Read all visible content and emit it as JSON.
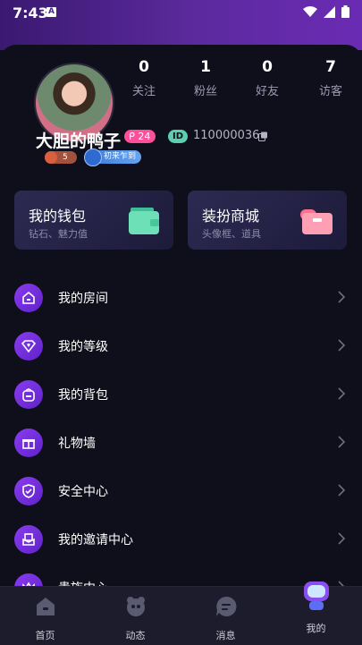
{
  "status_bar": {
    "time": "7:43",
    "notif_glyph": "A"
  },
  "profile": {
    "username": "大胆的鸭子",
    "level": "24",
    "id_label": "ID",
    "id_value": "110000036",
    "fire_level": "5",
    "newbie_badge": "初来乍到"
  },
  "stats": [
    {
      "num": "0",
      "label": "关注"
    },
    {
      "num": "1",
      "label": "粉丝"
    },
    {
      "num": "0",
      "label": "好友"
    },
    {
      "num": "7",
      "label": "访客"
    }
  ],
  "cards": {
    "wallet": {
      "title": "我的钱包",
      "subtitle": "钻石、魅力值"
    },
    "store": {
      "title": "装扮商城",
      "subtitle": "头像框、道具"
    }
  },
  "menu": [
    {
      "label": "我的房间",
      "icon": "home-icon"
    },
    {
      "label": "我的等级",
      "icon": "diamond-heart-icon"
    },
    {
      "label": "我的背包",
      "icon": "backpack-icon"
    },
    {
      "label": "礼物墙",
      "icon": "gift-icon"
    },
    {
      "label": "安全中心",
      "icon": "shield-icon"
    },
    {
      "label": "我的邀请中心",
      "icon": "invite-icon"
    },
    {
      "label": "贵族中心",
      "icon": "crown-icon"
    }
  ],
  "tabs": [
    {
      "label": "首页",
      "icon": "home-tab-icon"
    },
    {
      "label": "动态",
      "icon": "moments-tab-icon"
    },
    {
      "label": "消息",
      "icon": "message-tab-icon"
    },
    {
      "label": "我的",
      "icon": "me-tab-icon",
      "active": true
    }
  ],
  "colors": {
    "accent_purple": "#7b34e6",
    "level_pink": "#ff4f9a",
    "id_teal": "#5ccfb0",
    "background": "#0f0f1c"
  }
}
